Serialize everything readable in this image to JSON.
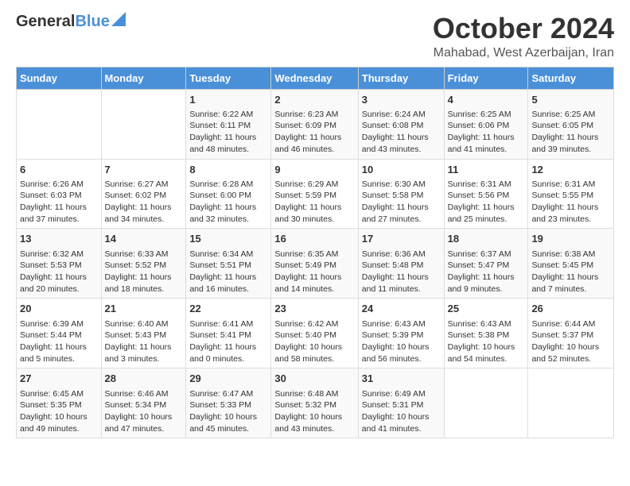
{
  "logo": {
    "general": "General",
    "blue": "Blue"
  },
  "header": {
    "month": "October 2024",
    "location": "Mahabad, West Azerbaijan, Iran"
  },
  "days_of_week": [
    "Sunday",
    "Monday",
    "Tuesday",
    "Wednesday",
    "Thursday",
    "Friday",
    "Saturday"
  ],
  "weeks": [
    [
      {
        "day": "",
        "content": ""
      },
      {
        "day": "",
        "content": ""
      },
      {
        "day": "1",
        "content": "Sunrise: 6:22 AM\nSunset: 6:11 PM\nDaylight: 11 hours and 48 minutes."
      },
      {
        "day": "2",
        "content": "Sunrise: 6:23 AM\nSunset: 6:09 PM\nDaylight: 11 hours and 46 minutes."
      },
      {
        "day": "3",
        "content": "Sunrise: 6:24 AM\nSunset: 6:08 PM\nDaylight: 11 hours and 43 minutes."
      },
      {
        "day": "4",
        "content": "Sunrise: 6:25 AM\nSunset: 6:06 PM\nDaylight: 11 hours and 41 minutes."
      },
      {
        "day": "5",
        "content": "Sunrise: 6:25 AM\nSunset: 6:05 PM\nDaylight: 11 hours and 39 minutes."
      }
    ],
    [
      {
        "day": "6",
        "content": "Sunrise: 6:26 AM\nSunset: 6:03 PM\nDaylight: 11 hours and 37 minutes."
      },
      {
        "day": "7",
        "content": "Sunrise: 6:27 AM\nSunset: 6:02 PM\nDaylight: 11 hours and 34 minutes."
      },
      {
        "day": "8",
        "content": "Sunrise: 6:28 AM\nSunset: 6:00 PM\nDaylight: 11 hours and 32 minutes."
      },
      {
        "day": "9",
        "content": "Sunrise: 6:29 AM\nSunset: 5:59 PM\nDaylight: 11 hours and 30 minutes."
      },
      {
        "day": "10",
        "content": "Sunrise: 6:30 AM\nSunset: 5:58 PM\nDaylight: 11 hours and 27 minutes."
      },
      {
        "day": "11",
        "content": "Sunrise: 6:31 AM\nSunset: 5:56 PM\nDaylight: 11 hours and 25 minutes."
      },
      {
        "day": "12",
        "content": "Sunrise: 6:31 AM\nSunset: 5:55 PM\nDaylight: 11 hours and 23 minutes."
      }
    ],
    [
      {
        "day": "13",
        "content": "Sunrise: 6:32 AM\nSunset: 5:53 PM\nDaylight: 11 hours and 20 minutes."
      },
      {
        "day": "14",
        "content": "Sunrise: 6:33 AM\nSunset: 5:52 PM\nDaylight: 11 hours and 18 minutes."
      },
      {
        "day": "15",
        "content": "Sunrise: 6:34 AM\nSunset: 5:51 PM\nDaylight: 11 hours and 16 minutes."
      },
      {
        "day": "16",
        "content": "Sunrise: 6:35 AM\nSunset: 5:49 PM\nDaylight: 11 hours and 14 minutes."
      },
      {
        "day": "17",
        "content": "Sunrise: 6:36 AM\nSunset: 5:48 PM\nDaylight: 11 hours and 11 minutes."
      },
      {
        "day": "18",
        "content": "Sunrise: 6:37 AM\nSunset: 5:47 PM\nDaylight: 11 hours and 9 minutes."
      },
      {
        "day": "19",
        "content": "Sunrise: 6:38 AM\nSunset: 5:45 PM\nDaylight: 11 hours and 7 minutes."
      }
    ],
    [
      {
        "day": "20",
        "content": "Sunrise: 6:39 AM\nSunset: 5:44 PM\nDaylight: 11 hours and 5 minutes."
      },
      {
        "day": "21",
        "content": "Sunrise: 6:40 AM\nSunset: 5:43 PM\nDaylight: 11 hours and 3 minutes."
      },
      {
        "day": "22",
        "content": "Sunrise: 6:41 AM\nSunset: 5:41 PM\nDaylight: 11 hours and 0 minutes."
      },
      {
        "day": "23",
        "content": "Sunrise: 6:42 AM\nSunset: 5:40 PM\nDaylight: 10 hours and 58 minutes."
      },
      {
        "day": "24",
        "content": "Sunrise: 6:43 AM\nSunset: 5:39 PM\nDaylight: 10 hours and 56 minutes."
      },
      {
        "day": "25",
        "content": "Sunrise: 6:43 AM\nSunset: 5:38 PM\nDaylight: 10 hours and 54 minutes."
      },
      {
        "day": "26",
        "content": "Sunrise: 6:44 AM\nSunset: 5:37 PM\nDaylight: 10 hours and 52 minutes."
      }
    ],
    [
      {
        "day": "27",
        "content": "Sunrise: 6:45 AM\nSunset: 5:35 PM\nDaylight: 10 hours and 49 minutes."
      },
      {
        "day": "28",
        "content": "Sunrise: 6:46 AM\nSunset: 5:34 PM\nDaylight: 10 hours and 47 minutes."
      },
      {
        "day": "29",
        "content": "Sunrise: 6:47 AM\nSunset: 5:33 PM\nDaylight: 10 hours and 45 minutes."
      },
      {
        "day": "30",
        "content": "Sunrise: 6:48 AM\nSunset: 5:32 PM\nDaylight: 10 hours and 43 minutes."
      },
      {
        "day": "31",
        "content": "Sunrise: 6:49 AM\nSunset: 5:31 PM\nDaylight: 10 hours and 41 minutes."
      },
      {
        "day": "",
        "content": ""
      },
      {
        "day": "",
        "content": ""
      }
    ]
  ]
}
